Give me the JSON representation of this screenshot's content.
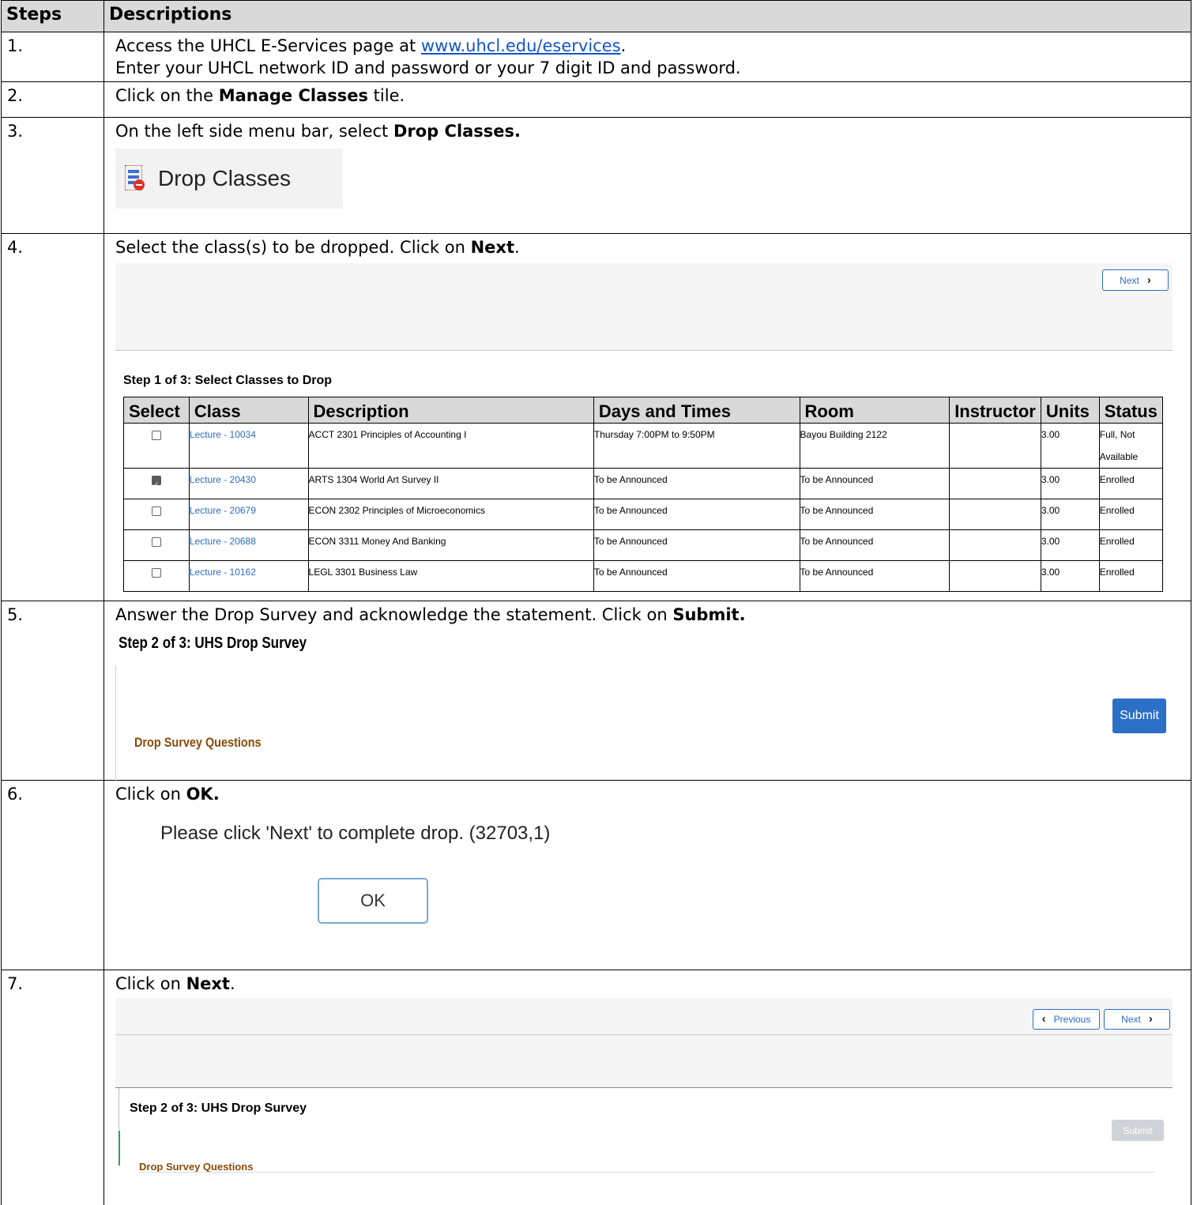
{
  "headers": {
    "steps": "Steps",
    "descriptions": "Descriptions"
  },
  "step1": {
    "num": "1.",
    "line1_prefix": "Access the UHCL E-Services page at ",
    "link": "www.uhcl.edu/eservices",
    "line1_suffix": ".",
    "line2": "Enter your UHCL network ID and password or your 7 digit ID and password."
  },
  "step2": {
    "num": "2.",
    "prefix": "Click on the ",
    "bold": "Manage Classes",
    "suffix": " tile."
  },
  "step3": {
    "num": "3.",
    "prefix": "On the left side menu bar, select ",
    "bold": "Drop Classes.",
    "button_label": "Drop Classes",
    "icon": "drop-classes-icon"
  },
  "step4": {
    "num": "4.",
    "prefix": "Select the class(s) to be dropped. Click on ",
    "bold": "Next",
    "suffix": ".",
    "next_label": "Next",
    "title": "Step 1 of 3: Select Classes to Drop",
    "columns": [
      "Select",
      "Class",
      "Description",
      "Days and Times",
      "Room",
      "Instructor",
      "Units",
      "Status"
    ],
    "rows": [
      {
        "checked": false,
        "class": "Lecture - 10034",
        "description": "ACCT 2301  Principles of Accounting I",
        "days": "Thursday   7:00PM to 9:50PM",
        "room": "Bayou Building 2122",
        "instructor": "",
        "units": "3.00",
        "status": "Full, Not Available"
      },
      {
        "checked": true,
        "class": "Lecture - 20430",
        "description": "ARTS 1304  World Art Survey II",
        "days": "To be Announced",
        "room": "To be Announced",
        "instructor": "",
        "units": "3.00",
        "status": "Enrolled"
      },
      {
        "checked": false,
        "class": "Lecture - 20679",
        "description": "ECON 2302  Principles of Microeconomics",
        "days": "To be Announced",
        "room": "To be Announced",
        "instructor": "",
        "units": "3.00",
        "status": "Enrolled"
      },
      {
        "checked": false,
        "class": "Lecture - 20688",
        "description": "ECON 3311  Money And Banking",
        "days": "To be Announced",
        "room": "To be Announced",
        "instructor": "",
        "units": "3.00",
        "status": "Enrolled"
      },
      {
        "checked": false,
        "class": "Lecture - 10162",
        "description": "LEGL 3301  Business Law",
        "days": "To be Announced",
        "room": "To be Announced",
        "instructor": "",
        "units": "3.00",
        "status": "Enrolled"
      }
    ]
  },
  "step5": {
    "num": "5.",
    "prefix": "Answer the Drop Survey and acknowledge the statement. Click on ",
    "bold": "Submit.",
    "title": "Step 2 of 3: UHS Drop Survey",
    "submit_label": "Submit",
    "questions": "Drop Survey Questions"
  },
  "step6": {
    "num": "6.",
    "prefix": "Click on ",
    "bold": "OK.",
    "message": "Please click 'Next' to complete drop. (32703,1)",
    "ok_label": "OK"
  },
  "step7": {
    "num": "7.",
    "prefix": "Click on ",
    "bold": "Next",
    "suffix": ".",
    "previous_label": "Previous",
    "next_label": "Next",
    "title": "Step 2 of 3: UHS Drop Survey",
    "submit_label": "Submit",
    "questions": "Drop Survey Questions"
  },
  "colors": {
    "link": "#1155cc",
    "ps_blue": "#2b6cc4",
    "survey_brown": "#8a4b08",
    "header_bg": "#d9d9d9"
  }
}
